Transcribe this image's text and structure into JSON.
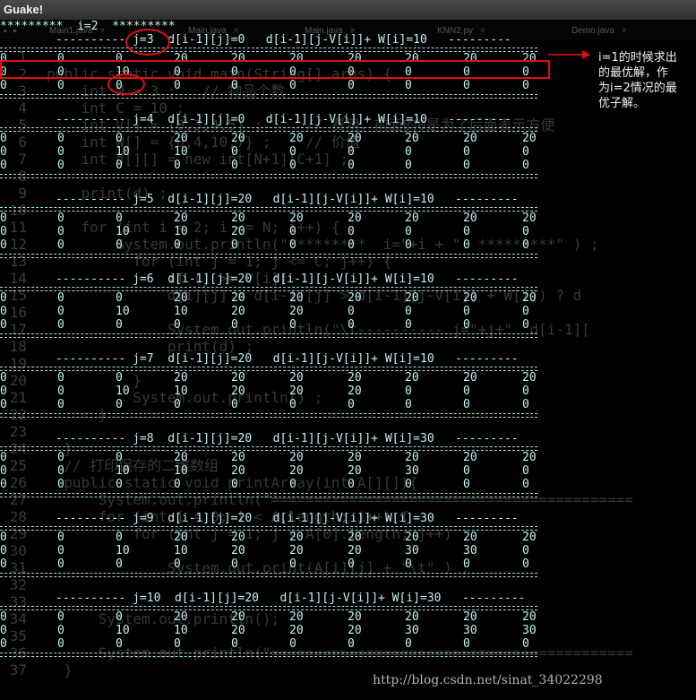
{
  "window": {
    "title": "Guake!"
  },
  "tab_arrows": "◂ ▸",
  "tabs": [
    {
      "label": "Main1.java"
    },
    {
      "label": "Main.java"
    },
    {
      "label": "Main.java"
    },
    {
      "label": "KNN2.py"
    },
    {
      "label": "Demo.java"
    }
  ],
  "gutter": [
    "1",
    "2",
    "3",
    "4",
    "5",
    "6",
    "7",
    "8",
    "9",
    "10",
    "11",
    "12",
    "13",
    "14",
    "15",
    "16",
    "17",
    "18",
    "19",
    "20",
    "21",
    "22",
    "23",
    "24",
    "25",
    "26",
    "27",
    "28",
    "29",
    "30",
    "31",
    "32",
    "33",
    "34",
    "35",
    "36",
    "37"
  ],
  "editor_lines": [
    {
      "row": 2,
      "text": "public static void main(String[] args) {"
    },
    {
      "row": 3,
      "text": "    int N = 3 ;   // 物品个数"
    },
    {
      "row": 4,
      "text": "    int C = 10 ;"
    },
    {
      "row": 5,
      "text": "    int V[] = {0,3,4,5} ;     // 费用，前面的0是为了后面表示方便"
    },
    {
      "row": 6,
      "text": "    int W[] = {0,4,10,7} ;    // 价值"
    },
    {
      "row": 7,
      "text": "    int d[][] = new int[N+1][C+1] ;"
    },
    {
      "row": 9,
      "text": "    print(d) ;"
    },
    {
      "row": 11,
      "text": "    for (int i = 2; i <= N; i++) {"
    },
    {
      "row": 12,
      "text": "        System.out.println(\"*********  i=\"+i + \"  *********\" ) ;"
    },
    {
      "row": 13,
      "text": "          for (int j = 1; j <= C; j++) {"
    },
    {
      "row": 14,
      "text": "              if (j >= V[i])"
    },
    {
      "row": 15,
      "text": "              d[i][j] = d[i-1][j] > d[i-1][j-V[i]] + W[i]) ? d"
    },
    {
      "row": 17,
      "text": "              System.out.println(\"\\t---------- j=\"+j+\"  d[i-1]["
    },
    {
      "row": 18,
      "text": "              print(d) ;"
    },
    {
      "row": 20,
      "text": "          }"
    },
    {
      "row": 21,
      "text": "          System.out.println() ;"
    },
    {
      "row": 22,
      "text": "      }"
    },
    {
      "row": 24,
      "text": "  }"
    },
    {
      "row": 25,
      "text": "  // 打印保存的二维数组"
    },
    {
      "row": 26,
      "text": "  public static void printArray(int A[][]){"
    },
    {
      "row": 27,
      "text": "      System.out.println(\"=========================================="
    },
    {
      "row": 28,
      "text": "      for (int i = 0; i < A.length; i++) {"
    },
    {
      "row": 29,
      "text": "          for (int j = 1; j < A[0].length; j++)"
    },
    {
      "row": 31,
      "text": "              System.out.print(A[i][j] + \"\\t\" ) ;"
    },
    {
      "row": 34,
      "text": "      System.out.println();"
    },
    {
      "row": 36,
      "text": "      System.out.println(\"=========================================="
    },
    {
      "row": 37,
      "text": "  }"
    }
  ],
  "terminal": {
    "i_header": "*********  i=2  *********",
    "blocks": [
      {
        "header": "---------- j=3  d[i-1][j]=0   d[i-1][j-V[i]]+ W[i]=10   ---------",
        "rows": [
          [
            "0",
            "0",
            "0",
            "20",
            "20",
            "20",
            "20",
            "20",
            "20",
            "20"
          ],
          [
            "0",
            "0",
            "10",
            "0",
            "0",
            "0",
            "0",
            "0",
            "0",
            "0"
          ],
          [
            "0",
            "0",
            "0",
            "0",
            "0",
            "0",
            "0",
            "0",
            "0",
            "0"
          ]
        ]
      },
      {
        "header": "---------- j=4  d[i-1][j]=0   d[i-1][j-V[i]]+ W[i]=10   ---------",
        "rows": [
          [
            "0",
            "0",
            "0",
            "20",
            "20",
            "20",
            "20",
            "20",
            "20",
            "20"
          ],
          [
            "0",
            "0",
            "10",
            "10",
            "0",
            "0",
            "0",
            "0",
            "0",
            "0"
          ],
          [
            "0",
            "0",
            "0",
            "0",
            "0",
            "0",
            "0",
            "0",
            "0",
            "0"
          ]
        ]
      },
      {
        "header": "---------- j=5  d[i-1][j]=20   d[i-1][j-V[i]]+ W[i]=10   ---------",
        "rows": [
          [
            "0",
            "0",
            "0",
            "20",
            "20",
            "20",
            "20",
            "20",
            "20",
            "20"
          ],
          [
            "0",
            "0",
            "10",
            "10",
            "20",
            "0",
            "0",
            "0",
            "0",
            "0"
          ],
          [
            "0",
            "0",
            "0",
            "0",
            "0",
            "0",
            "0",
            "0",
            "0",
            "0"
          ]
        ]
      },
      {
        "header": "---------- j=6  d[i-1][j]=20   d[i-1][j-V[i]]+ W[i]=10   ---------",
        "rows": [
          [
            "0",
            "0",
            "0",
            "20",
            "20",
            "20",
            "20",
            "20",
            "20",
            "20"
          ],
          [
            "0",
            "0",
            "10",
            "10",
            "20",
            "20",
            "0",
            "0",
            "0",
            "0"
          ],
          [
            "0",
            "0",
            "0",
            "0",
            "0",
            "0",
            "0",
            "0",
            "0",
            "0"
          ]
        ]
      },
      {
        "header": "---------- j=7  d[i-1][j]=20   d[i-1][j-V[i]]+ W[i]=10   ---------",
        "rows": [
          [
            "0",
            "0",
            "0",
            "20",
            "20",
            "20",
            "20",
            "20",
            "20",
            "20"
          ],
          [
            "0",
            "0",
            "10",
            "10",
            "20",
            "20",
            "20",
            "0",
            "0",
            "0"
          ],
          [
            "0",
            "0",
            "0",
            "0",
            "0",
            "0",
            "0",
            "0",
            "0",
            "0"
          ]
        ]
      },
      {
        "header": "---------- j=8  d[i-1][j]=20   d[i-1][j-V[i]]+ W[i]=30   ---------",
        "rows": [
          [
            "0",
            "0",
            "0",
            "20",
            "20",
            "20",
            "20",
            "20",
            "20",
            "20"
          ],
          [
            "0",
            "0",
            "10",
            "10",
            "20",
            "20",
            "20",
            "30",
            "0",
            "0"
          ],
          [
            "0",
            "0",
            "0",
            "0",
            "0",
            "0",
            "0",
            "0",
            "0",
            "0"
          ]
        ]
      },
      {
        "header": "---------- j=9  d[i-1][j]=20   d[i-1][j-V[i]]+ W[i]=30   ---------",
        "rows": [
          [
            "0",
            "0",
            "0",
            "20",
            "20",
            "20",
            "20",
            "20",
            "20",
            "20"
          ],
          [
            "0",
            "0",
            "10",
            "10",
            "20",
            "20",
            "20",
            "30",
            "30",
            "0"
          ],
          [
            "0",
            "0",
            "0",
            "0",
            "0",
            "0",
            "0",
            "0",
            "0",
            "0"
          ]
        ]
      },
      {
        "header": "---------- j=10  d[i-1][j]=20   d[i-1][j-V[i]]+ W[i]=30   ---------",
        "rows": [
          [
            "0",
            "0",
            "0",
            "20",
            "20",
            "20",
            "20",
            "20",
            "20",
            "20"
          ],
          [
            "0",
            "0",
            "10",
            "10",
            "20",
            "20",
            "20",
            "30",
            "30",
            "30"
          ],
          [
            "0",
            "0",
            "0",
            "0",
            "0",
            "0",
            "0",
            "0",
            "0",
            "0"
          ]
        ]
      }
    ]
  },
  "annotation": {
    "lines": [
      "i=1的时候求出",
      "的最优解，作",
      "为i=2情况的最",
      "优子解。"
    ]
  },
  "watermark": "http://blog.csdn.net/sinat_34022298",
  "colors": {
    "terminal_text": "#c4f0f0",
    "highlight": "#e01010",
    "background": "#000000"
  }
}
